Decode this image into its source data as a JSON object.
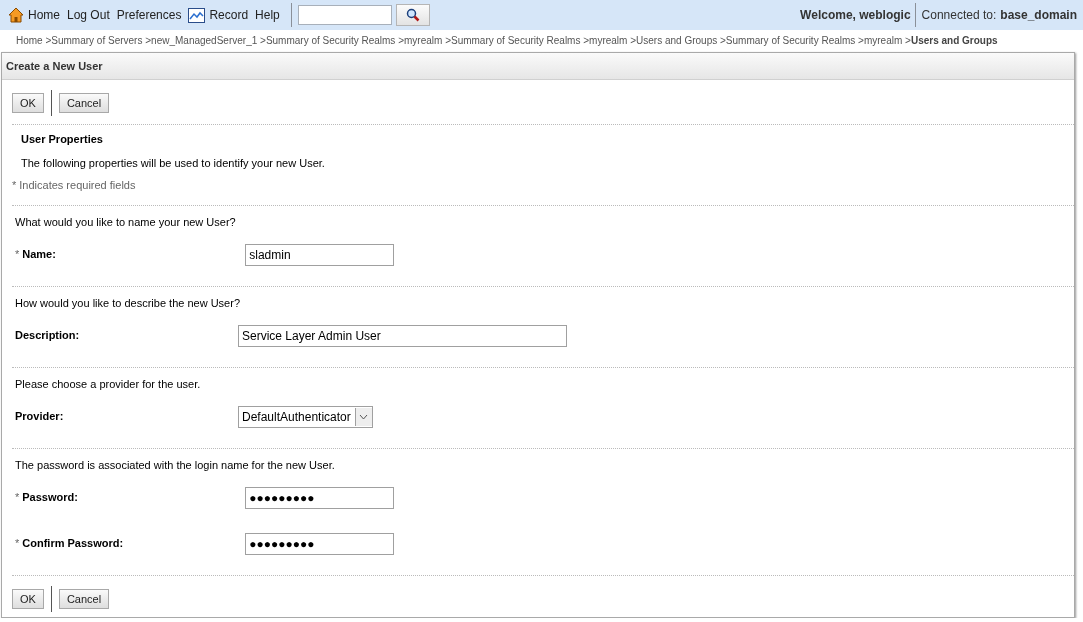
{
  "toolbar": {
    "links": [
      "Home",
      "Log Out",
      "Preferences",
      "Record",
      "Help"
    ],
    "welcome": "Welcome, weblogic",
    "connected_label": "Connected to:",
    "domain": "base_domain"
  },
  "breadcrumb_separator": ">",
  "breadcrumbs": [
    {
      "label": "Home",
      "current": false
    },
    {
      "label": "Summary of Servers",
      "current": false
    },
    {
      "label": "new_ManagedServer_1",
      "current": false
    },
    {
      "label": "Summary of Security Realms",
      "current": false
    },
    {
      "label": "myrealm",
      "current": false
    },
    {
      "label": "Summary of Security Realms",
      "current": false
    },
    {
      "label": "myrealm",
      "current": false
    },
    {
      "label": "Users and Groups",
      "current": false
    },
    {
      "label": "Summary of Security Realms",
      "current": false
    },
    {
      "label": "myrealm",
      "current": false
    },
    {
      "label": "Users and Groups",
      "current": true
    }
  ],
  "panel": {
    "title": "Create a New User",
    "buttons": [
      "OK",
      "Cancel"
    ],
    "section_title": "User Properties",
    "intro": "The following properties will be used to identify your new User.",
    "required_mark": "*",
    "required_note": "Indicates required fields",
    "sections": [
      {
        "prompt": "What would you like to name your new User?",
        "fields": [
          {
            "kind": "text",
            "label": "Name:",
            "required": true,
            "value": "sladmin"
          }
        ]
      },
      {
        "prompt": "How would you like to describe the new User?",
        "fields": [
          {
            "kind": "wide",
            "label": "Description:",
            "required": false,
            "value": "Service Layer Admin User"
          }
        ]
      },
      {
        "prompt": "Please choose a provider for the user.",
        "fields": [
          {
            "kind": "select",
            "label": "Provider:",
            "required": false,
            "value": "DefaultAuthenticator"
          }
        ]
      },
      {
        "prompt": "The password is associated with the login name for the new User.",
        "fields": [
          {
            "kind": "password",
            "label": "Password:",
            "required": true,
            "value": "●●●●●●●●●"
          },
          {
            "kind": "password",
            "label": "Confirm Password:",
            "required": true,
            "value": "●●●●●●●●●"
          }
        ]
      }
    ],
    "bottom_buttons": [
      "OK",
      "Cancel"
    ]
  }
}
